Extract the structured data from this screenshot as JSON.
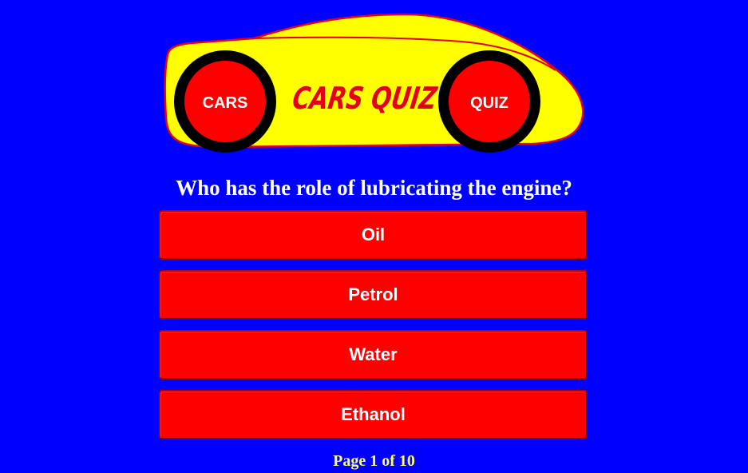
{
  "logo": {
    "title": "CARS QUIZ",
    "left_wheel_label": "CARS",
    "right_wheel_label": "QUIZ",
    "car_body_color": "#ffff00",
    "outline_color": "#e4001b",
    "wheel_fill_color": "#ff0000",
    "tire_color": "#000000"
  },
  "question": {
    "text": "Who has the role of lubricating the engine?"
  },
  "answers": [
    {
      "label": "Oil"
    },
    {
      "label": "Petrol"
    },
    {
      "label": "Water"
    },
    {
      "label": "Ethanol"
    }
  ],
  "pager": {
    "text": "Page 1 of 10"
  },
  "colors": {
    "background": "#0000ff",
    "button": "#ff0000",
    "button_text": "#ffffff",
    "question_text": "#ffffff",
    "pager_text": "#ffff66"
  }
}
